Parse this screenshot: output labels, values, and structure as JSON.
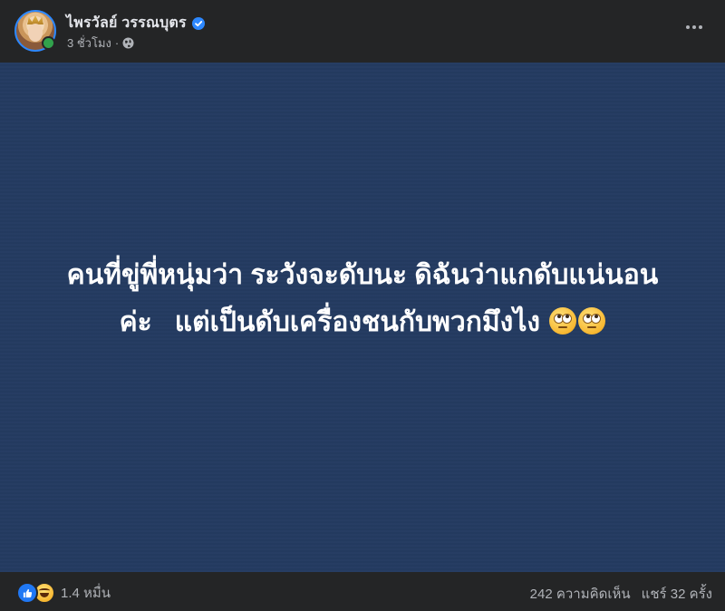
{
  "post": {
    "author": {
      "name": "ไพรวัลย์ วรรณบุตร",
      "verified": true,
      "online": true
    },
    "timestamp": "3 ชั่วโมง",
    "audience_icon": "globe-icon",
    "text_lines": [
      "คนที่ขู่พี่หนุ่มว่า ระวังจะดับนะ ดิฉันว่าแกดับแน่นอน",
      "ค่ะ   แต่เป็นดับเครื่องชนกับพวกมึงไง"
    ],
    "emojis": [
      "face-with-rolling-eyes-icon",
      "face-with-rolling-eyes-icon"
    ],
    "background_color": "#243b61",
    "reactions": {
      "icons": [
        "like-icon",
        "haha-icon"
      ],
      "count": "1.4 หมื่น"
    },
    "comments": "242 ความคิดเห็น",
    "shares": "แชร์ 32 ครั้ง"
  },
  "colors": {
    "accent": "#2d88ff",
    "online": "#31a24c",
    "like": "#2078f4",
    "surface": "#242526",
    "text_secondary": "#b0b3b8"
  }
}
